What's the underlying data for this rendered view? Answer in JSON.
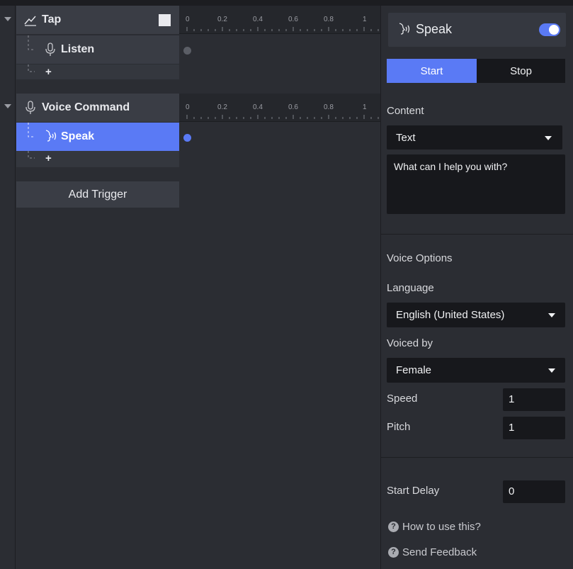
{
  "triggers": [
    {
      "name": "Tap",
      "actions": [
        {
          "label": "Listen"
        }
      ]
    },
    {
      "name": "Voice Command",
      "actions": [
        {
          "label": "Speak"
        }
      ]
    }
  ],
  "add_action_label": "+",
  "add_trigger_label": "Add Trigger",
  "ruler_ticks": [
    "0",
    "0.2",
    "0.4",
    "0.6",
    "0.8",
    "1"
  ],
  "panel": {
    "title": "Speak",
    "enabled": true,
    "tabs": {
      "start": "Start",
      "stop": "Stop",
      "active": "start"
    },
    "content_label": "Content",
    "content_type": "Text",
    "content_text": "What can I help you with?",
    "voice_options_label": "Voice Options",
    "language_label": "Language",
    "language_value": "English (United States)",
    "voiced_by_label": "Voiced by",
    "voiced_by_value": "Female",
    "speed_label": "Speed",
    "speed_value": "1",
    "pitch_label": "Pitch",
    "pitch_value": "1",
    "start_delay_label": "Start Delay",
    "start_delay_value": "0",
    "help_how_to": "How to use this?",
    "help_feedback": "Send Feedback",
    "help_icon_glyph": "?"
  },
  "colors": {
    "accent": "#5a7af5",
    "inactive_dot": "#5b5e66"
  }
}
